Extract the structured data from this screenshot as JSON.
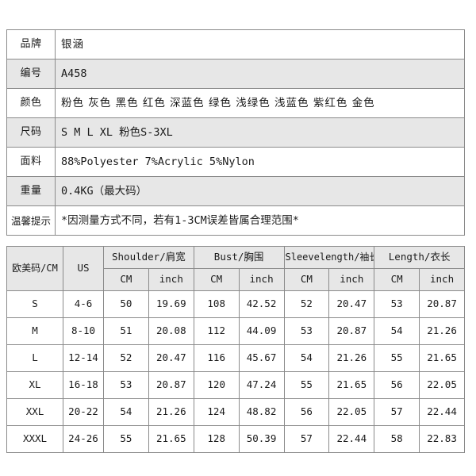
{
  "spec_table": {
    "rows": [
      {
        "label": "品牌",
        "value": "银涵"
      },
      {
        "label": "编号",
        "value": "A458"
      },
      {
        "label": "颜色",
        "value": "粉色 灰色 黑色 红色 深蓝色 绿色 浅绿色 浅蓝色 紫红色 金色"
      },
      {
        "label": "尺码",
        "value": "S M L XL  粉色S-3XL"
      },
      {
        "label": "面料",
        "value": "88%Polyester  7%Acrylic  5%Nylon"
      },
      {
        "label": "重量",
        "value": "0.4KG（最大码）"
      },
      {
        "label": "温馨提示",
        "value": "*因测量方式不同，若有1-3CM误差皆属合理范围*"
      }
    ]
  },
  "size_chart": {
    "group_headers": [
      "欧美码/CM",
      "US",
      "Shoulder/肩宽",
      "Bust/胸围",
      "Sleevelength/袖长",
      "Length/衣长"
    ],
    "unit_headers": [
      "",
      "",
      "CM",
      "inch",
      "CM",
      "inch",
      "CM",
      "inch",
      "CM",
      "inch"
    ],
    "rows": [
      {
        "size": "S",
        "us": "4-6",
        "shoulder_cm": "50",
        "shoulder_in": "19.69",
        "bust_cm": "108",
        "bust_in": "42.52",
        "sleeve_cm": "52",
        "sleeve_in": "20.47",
        "length_cm": "53",
        "length_in": "20.87"
      },
      {
        "size": "M",
        "us": "8-10",
        "shoulder_cm": "51",
        "shoulder_in": "20.08",
        "bust_cm": "112",
        "bust_in": "44.09",
        "sleeve_cm": "53",
        "sleeve_in": "20.87",
        "length_cm": "54",
        "length_in": "21.26"
      },
      {
        "size": "L",
        "us": "12-14",
        "shoulder_cm": "52",
        "shoulder_in": "20.47",
        "bust_cm": "116",
        "bust_in": "45.67",
        "sleeve_cm": "54",
        "sleeve_in": "21.26",
        "length_cm": "55",
        "length_in": "21.65"
      },
      {
        "size": "XL",
        "us": "16-18",
        "shoulder_cm": "53",
        "shoulder_in": "20.87",
        "bust_cm": "120",
        "bust_in": "47.24",
        "sleeve_cm": "55",
        "sleeve_in": "21.65",
        "length_cm": "56",
        "length_in": "22.05"
      },
      {
        "size": "XXL",
        "us": "20-22",
        "shoulder_cm": "54",
        "shoulder_in": "21.26",
        "bust_cm": "124",
        "bust_in": "48.82",
        "sleeve_cm": "56",
        "sleeve_in": "22.05",
        "length_cm": "57",
        "length_in": "22.44"
      },
      {
        "size": "XXXL",
        "us": "24-26",
        "shoulder_cm": "55",
        "shoulder_in": "21.65",
        "bust_cm": "128",
        "bust_in": "50.39",
        "sleeve_cm": "57",
        "sleeve_in": "22.44",
        "length_cm": "58",
        "length_in": "22.83"
      }
    ]
  },
  "colors": {
    "border": "#8a8a8a",
    "row_alt_background": "#e7e7e7",
    "header_background": "#e7e7e7",
    "page_background": "#ffffff",
    "text": "#1a1a1a"
  }
}
